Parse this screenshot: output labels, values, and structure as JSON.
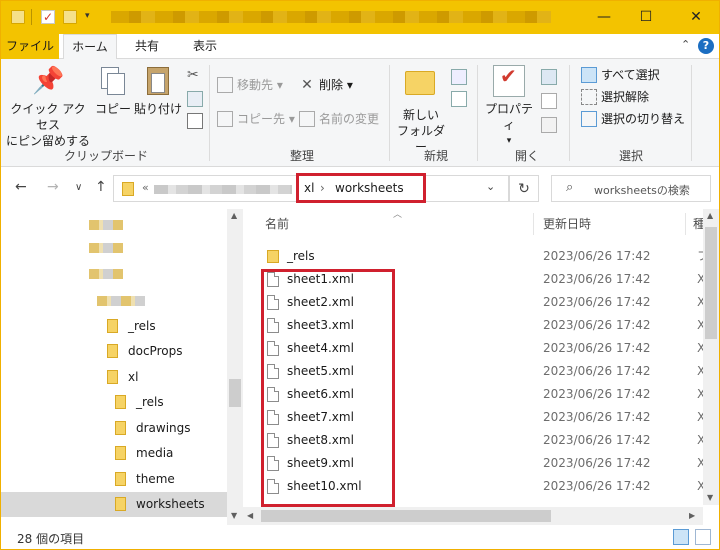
{
  "window": {
    "controls": {
      "minimize": "—",
      "maximize": "☐",
      "close": "✕"
    }
  },
  "ribbon_tabs": {
    "file": "ファイル",
    "home": "ホーム",
    "share": "共有",
    "view": "表示"
  },
  "ribbon": {
    "clipboard": {
      "pin_label_line1": "クイック アクセス",
      "pin_label_line2": "にピン留めする",
      "copy": "コピー",
      "paste": "貼り付け",
      "group_label": "クリップボード"
    },
    "organize": {
      "move_to": "移動先",
      "copy_to": "コピー先",
      "delete": "削除",
      "rename": "名前の変更",
      "group_label": "整理"
    },
    "new": {
      "new_folder_line1": "新しい",
      "new_folder_line2": "フォルダー",
      "group_label": "新規"
    },
    "open": {
      "properties": "プロパティ",
      "group_label": "開く"
    },
    "select": {
      "select_all": "すべて選択",
      "select_none": "選択解除",
      "invert_selection": "選択の切り替え",
      "group_label": "選択"
    }
  },
  "address_bar": {
    "prefix": "«",
    "crumbs": [
      "xl",
      "worksheets"
    ],
    "crumb_separator": "›",
    "search_placeholder": "worksheetsの検索"
  },
  "nav_pane": {
    "items": [
      {
        "label": "_rels",
        "indent": 1
      },
      {
        "label": "docProps",
        "indent": 1
      },
      {
        "label": "xl",
        "indent": 1
      },
      {
        "label": "_rels",
        "indent": 2
      },
      {
        "label": "drawings",
        "indent": 2
      },
      {
        "label": "media",
        "indent": 2
      },
      {
        "label": "theme",
        "indent": 2
      },
      {
        "label": "worksheets",
        "indent": 2,
        "selected": true
      }
    ]
  },
  "file_list": {
    "columns": {
      "name": "名前",
      "modified": "更新日時",
      "type": "種"
    },
    "rows": [
      {
        "name": "_rels",
        "date": "2023/06/26 17:42",
        "type": "フ",
        "kind": "folder"
      },
      {
        "name": "sheet1.xml",
        "date": "2023/06/26 17:42",
        "type": "X",
        "kind": "file"
      },
      {
        "name": "sheet2.xml",
        "date": "2023/06/26 17:42",
        "type": "X",
        "kind": "file"
      },
      {
        "name": "sheet3.xml",
        "date": "2023/06/26 17:42",
        "type": "X",
        "kind": "file"
      },
      {
        "name": "sheet4.xml",
        "date": "2023/06/26 17:42",
        "type": "X",
        "kind": "file"
      },
      {
        "name": "sheet5.xml",
        "date": "2023/06/26 17:42",
        "type": "X",
        "kind": "file"
      },
      {
        "name": "sheet6.xml",
        "date": "2023/06/26 17:42",
        "type": "X",
        "kind": "file"
      },
      {
        "name": "sheet7.xml",
        "date": "2023/06/26 17:42",
        "type": "X",
        "kind": "file"
      },
      {
        "name": "sheet8.xml",
        "date": "2023/06/26 17:42",
        "type": "X",
        "kind": "file"
      },
      {
        "name": "sheet9.xml",
        "date": "2023/06/26 17:42",
        "type": "X",
        "kind": "file"
      },
      {
        "name": "sheet10.xml",
        "date": "2023/06/26 17:42",
        "type": "X",
        "kind": "file"
      }
    ]
  },
  "status": {
    "item_count": "28 個の項目"
  },
  "colors": {
    "titlebar": "#f3c300",
    "highlight": "#d0202e",
    "folder": "#f6d365"
  }
}
